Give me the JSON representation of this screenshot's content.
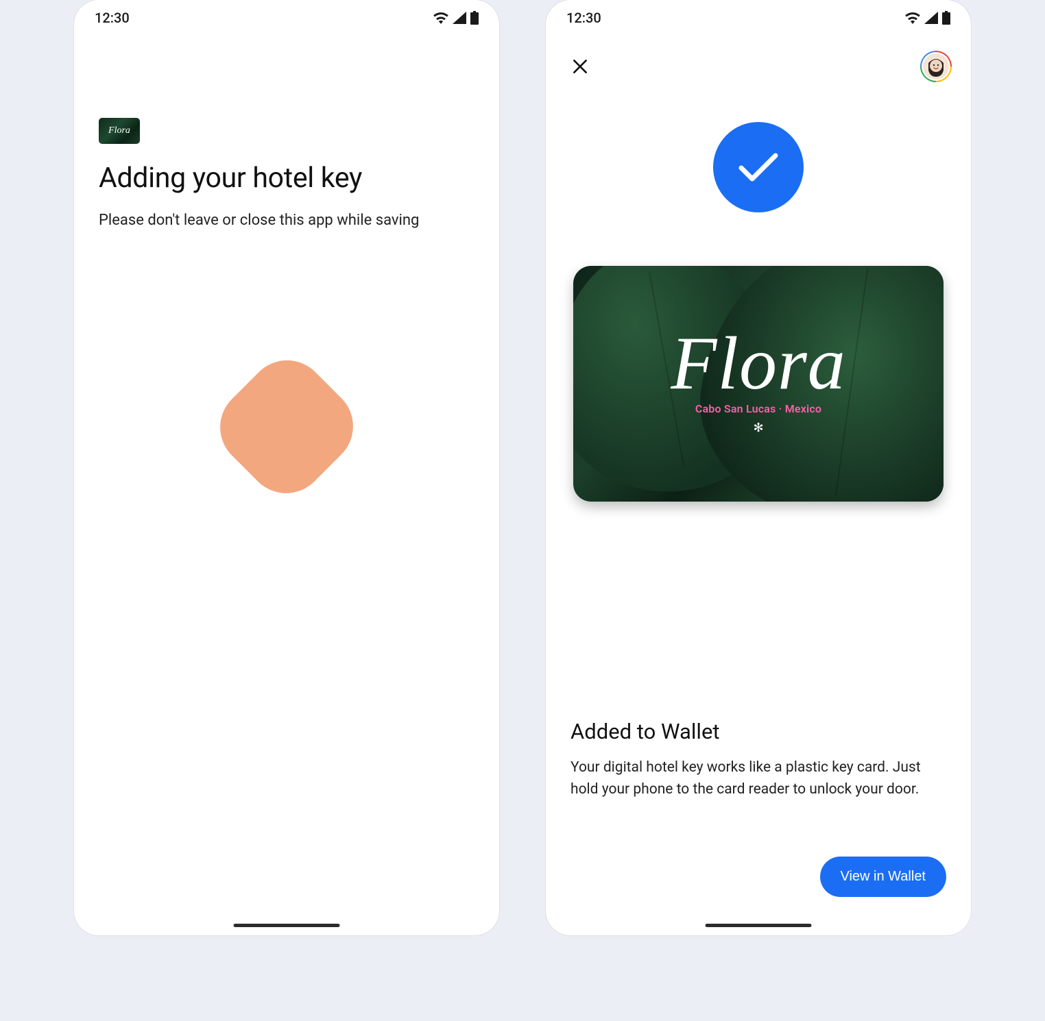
{
  "status": {
    "time": "12:30"
  },
  "screen1": {
    "brand": "Flora",
    "title": "Adding your hotel key",
    "subtitle": "Please don't leave or close this app while saving"
  },
  "screen2": {
    "card": {
      "brand": "Flora",
      "location_line": "Cabo San Lucas · Mexico"
    },
    "heading": "Added to Wallet",
    "body": "Your digital hotel key works like a plastic key card. Just hold your phone to the card reader to unlock your door.",
    "cta": "View in Wallet"
  }
}
